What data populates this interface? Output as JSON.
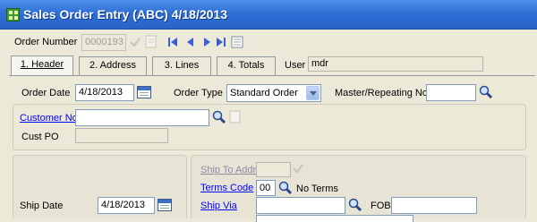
{
  "window": {
    "title": "Sales Order Entry (ABC) 4/18/2013",
    "icon": "app-grid-icon"
  },
  "order": {
    "number_label": "Order Number",
    "number_value": "0000193",
    "user_label": "User",
    "user_value": "mdr"
  },
  "tabs": [
    {
      "label": "1. Header",
      "active": true
    },
    {
      "label": "2. Address",
      "active": false
    },
    {
      "label": "3. Lines",
      "active": false
    },
    {
      "label": "4. Totals",
      "active": false
    }
  ],
  "header": {
    "order_date_label": "Order Date",
    "order_date_value": "4/18/2013",
    "order_type_label": "Order Type",
    "order_type_value": "Standard Order",
    "master_label": "Master/Repeating No.",
    "master_value": "",
    "customer_no_label": "Customer No.",
    "customer_no_value": "",
    "cust_po_label": "Cust PO",
    "cust_po_value": ""
  },
  "shipping": {
    "ship_to_label": "Ship To Addr",
    "ship_to_value": "",
    "terms_code_label": "Terms Code",
    "terms_code_value": "00",
    "terms_desc": "No Terms",
    "ship_via_label": "Ship Via",
    "ship_via_value": "",
    "fob_label": "FOB",
    "fob_value": "",
    "ship_date_label": "Ship Date",
    "ship_date_value": "4/18/2013"
  },
  "colors": {
    "titlebar": "#2f6fd6",
    "window_bg": "#ece9d8",
    "link": "#0000ff"
  }
}
